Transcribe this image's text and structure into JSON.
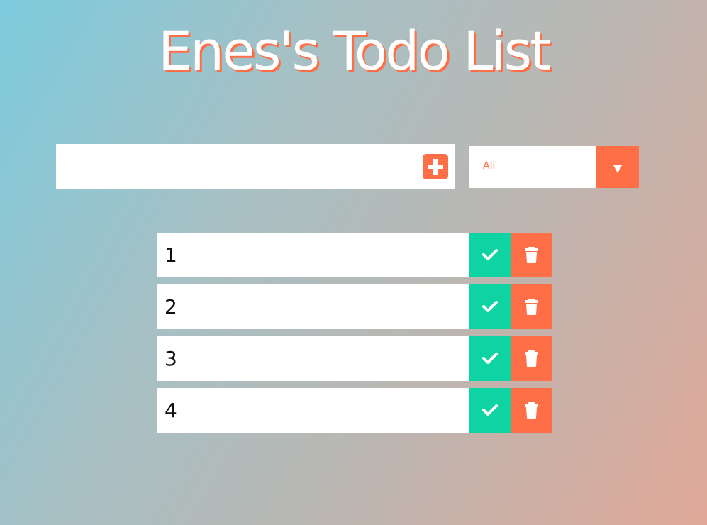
{
  "header": {
    "title": "Enes's Todo List"
  },
  "form": {
    "input_value": "",
    "input_placeholder": "",
    "add_icon": "plus-square-icon",
    "filter": {
      "selected": "All",
      "options": [
        "All"
      ],
      "arrow_icon": "caret-down-icon"
    }
  },
  "todos": [
    {
      "text": "1",
      "complete_icon": "check-icon",
      "delete_icon": "trash-icon"
    },
    {
      "text": "2",
      "complete_icon": "check-icon",
      "delete_icon": "trash-icon"
    },
    {
      "text": "3",
      "complete_icon": "check-icon",
      "delete_icon": "trash-icon"
    },
    {
      "text": "4",
      "complete_icon": "check-icon",
      "delete_icon": "trash-icon"
    }
  ],
  "colors": {
    "accent": "#ff6f47",
    "complete": "#0ed4a3",
    "background_start": "#7ccbdd",
    "background_end": "#e0a898"
  }
}
